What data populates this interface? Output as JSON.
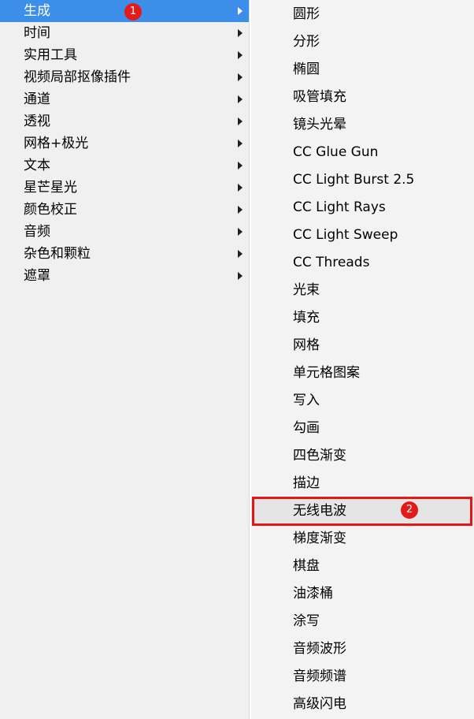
{
  "left_menu": {
    "items": [
      {
        "label": "生成",
        "has_submenu": true,
        "selected": true
      },
      {
        "label": "时间",
        "has_submenu": true
      },
      {
        "label": "实用工具",
        "has_submenu": true
      },
      {
        "label": "视频局部抠像插件",
        "has_submenu": true
      },
      {
        "label": "通道",
        "has_submenu": true
      },
      {
        "label": "透视",
        "has_submenu": true
      },
      {
        "label": "网格+极光",
        "has_submenu": true
      },
      {
        "label": "文本",
        "has_submenu": true
      },
      {
        "label": "星芒星光",
        "has_submenu": true
      },
      {
        "label": "颜色校正",
        "has_submenu": true
      },
      {
        "label": "音频",
        "has_submenu": true
      },
      {
        "label": "杂色和颗粒",
        "has_submenu": true
      },
      {
        "label": "遮罩",
        "has_submenu": true
      }
    ],
    "selected_color": "#3c8ee8"
  },
  "submenu": {
    "items": [
      {
        "label": "圆形"
      },
      {
        "label": "分形"
      },
      {
        "label": "椭圆"
      },
      {
        "label": "吸管填充"
      },
      {
        "label": "镜头光晕"
      },
      {
        "label": "CC Glue Gun"
      },
      {
        "label": "CC Light Burst 2.5"
      },
      {
        "label": "CC Light Rays"
      },
      {
        "label": "CC Light Sweep"
      },
      {
        "label": "CC Threads"
      },
      {
        "label": "光束"
      },
      {
        "label": "填充"
      },
      {
        "label": "网格"
      },
      {
        "label": "单元格图案"
      },
      {
        "label": "写入"
      },
      {
        "label": "勾画"
      },
      {
        "label": "四色渐变"
      },
      {
        "label": "描边"
      },
      {
        "label": "无线电波",
        "highlighted": true
      },
      {
        "label": "梯度渐变"
      },
      {
        "label": "棋盘"
      },
      {
        "label": "油漆桶"
      },
      {
        "label": "涂写"
      },
      {
        "label": "音频波形"
      },
      {
        "label": "音频频谱"
      },
      {
        "label": "高级闪电"
      }
    ]
  },
  "annotations": {
    "step1": "1",
    "step2": "2",
    "highlight_color": "#e21717"
  },
  "icons": {
    "submenu_arrow": "triangle-right-icon"
  }
}
